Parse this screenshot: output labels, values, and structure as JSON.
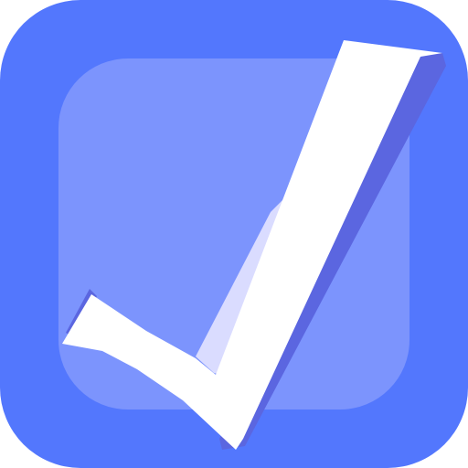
{
  "icon": {
    "name": "checkmark-app-icon",
    "colors": {
      "outer_tile": "#5377FD",
      "inner_tile": "#7C94FD",
      "check_face": "#FFFFFF",
      "check_shadow": "#5B66E0",
      "check_fold": "#DADCFF"
    }
  }
}
